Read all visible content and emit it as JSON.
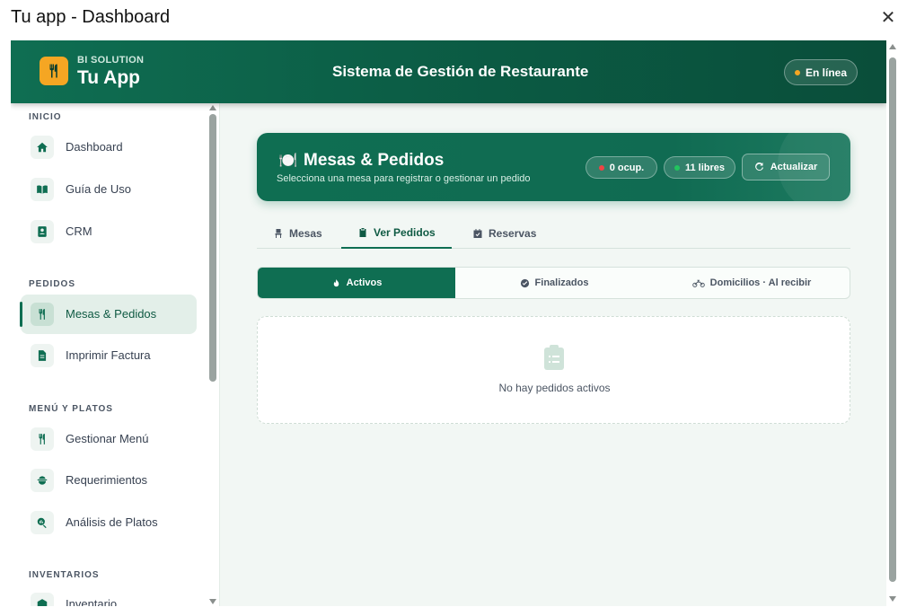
{
  "window": {
    "title": "Tu app - Dashboard",
    "close_glyph": "✕"
  },
  "header": {
    "brand_sub": "BI SOLUTION",
    "brand_name": "Tu App",
    "title": "Sistema de Gestión de Restaurante",
    "status": "En línea",
    "status_color": "#f5a623",
    "brand_icon": "fork-knife-icon"
  },
  "sidebar": {
    "sections": [
      {
        "label": "INICIO"
      },
      {
        "label": "PEDIDOS"
      },
      {
        "label": "MENÚ Y PLATOS"
      },
      {
        "label": "INVENTARIOS"
      }
    ],
    "items": [
      {
        "label": "Dashboard",
        "icon": "home-icon"
      },
      {
        "label": "Guía de Uso",
        "icon": "book-icon"
      },
      {
        "label": "CRM",
        "icon": "contact-card-icon"
      },
      {
        "label": "Mesas & Pedidos",
        "icon": "fork-knife-icon",
        "active": true
      },
      {
        "label": "Imprimir Factura",
        "icon": "document-icon"
      },
      {
        "label": "Gestionar Menú",
        "icon": "fork-knife-icon"
      },
      {
        "label": "Requerimientos",
        "icon": "pot-icon"
      },
      {
        "label": "Análisis de Platos",
        "icon": "magnifier-chart-icon"
      },
      {
        "label": "Inventario",
        "icon": "box-icon"
      }
    ]
  },
  "banner": {
    "icon": "🍽️",
    "title": "Mesas & Pedidos",
    "subtitle": "Selecciona una mesa para registrar o gestionar un pedido",
    "occupied_label": "0 ocup.",
    "free_label": "11 libres",
    "refresh_label": "Actualizar",
    "occupied_color": "#ef4444",
    "free_color": "#22c55e"
  },
  "tabs": [
    {
      "label": "Mesas",
      "icon": "chair-icon"
    },
    {
      "label": "Ver Pedidos",
      "icon": "clipboard-icon",
      "active": true
    },
    {
      "label": "Reservas",
      "icon": "calendar-check-icon"
    }
  ],
  "subtabs": [
    {
      "label": "Activos",
      "icon": "fire-icon",
      "active": true
    },
    {
      "label": "Finalizados",
      "icon": "check-circle-icon"
    },
    {
      "label": "Domicilios · Al recibir",
      "icon": "motorcycle-icon"
    }
  ],
  "empty": {
    "text": "No hay pedidos activos",
    "icon": "clipboard-list-icon"
  },
  "colors": {
    "primary": "#0f6e52",
    "accent": "#f5a623"
  }
}
